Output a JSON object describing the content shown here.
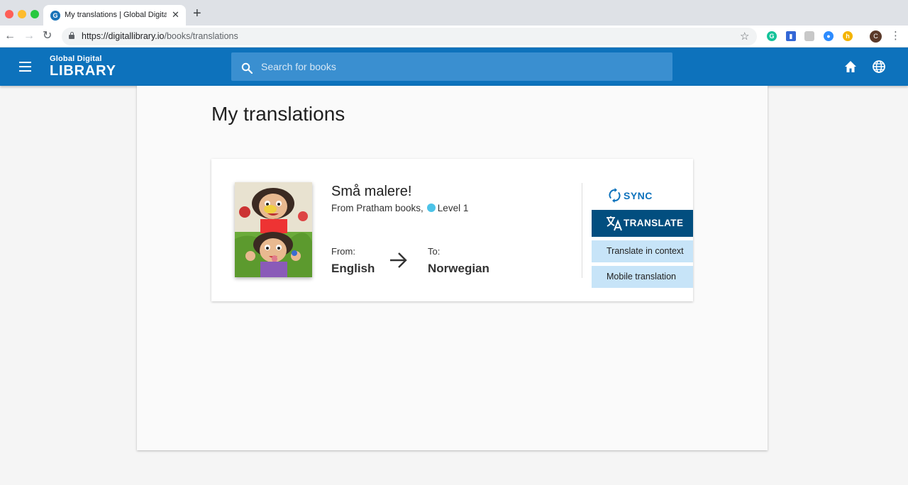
{
  "browser": {
    "tab_title": "My translations | Global Digital Library",
    "tab_favicon": "G",
    "tab_close": "✕",
    "new_tab": "+",
    "url_host": "https://digitallibrary.io",
    "url_path": "/books/translations",
    "profile_initial": "C",
    "extensions": [
      "grammarly-icon",
      "bookmark-extension-icon",
      "speech-extension-icon",
      "zoom-icon",
      "honey-icon"
    ]
  },
  "header": {
    "logo_top": "Global Digital",
    "logo_bottom": "LIBRARY",
    "search_placeholder": "Search for books",
    "accent_color": "#0d72bc"
  },
  "main": {
    "title": "My translations",
    "translations": [
      {
        "book_title": "Små malere!",
        "publisher": "From Pratham books,",
        "level": "Level 1",
        "level_color": "#4cc3e8",
        "from_label": "From:",
        "from_language": "English",
        "to_label": "To:",
        "to_language": "Norwegian",
        "sync_label": "SYNC",
        "translate_label": "TRANSLATE",
        "options": [
          "Translate in context",
          "Mobile translation"
        ]
      }
    ]
  }
}
